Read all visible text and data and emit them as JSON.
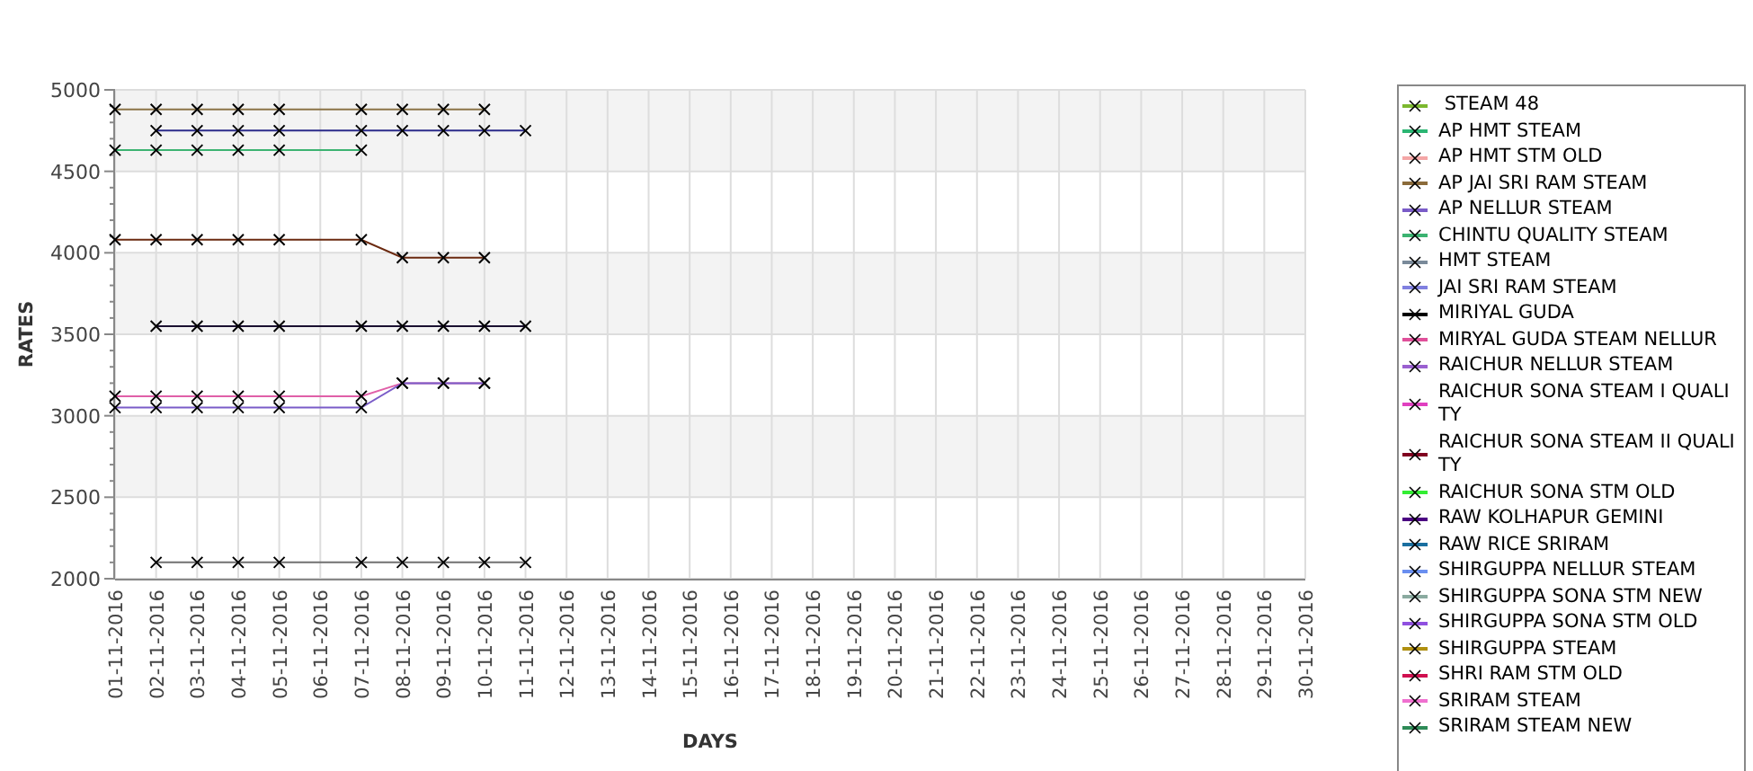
{
  "chart_data": {
    "type": "line",
    "xlabel": "DAYS",
    "ylabel": "RATES",
    "grid": true,
    "categories": [
      "01-11-2016",
      "02-11-2016",
      "03-11-2016",
      "04-11-2016",
      "05-11-2016",
      "06-11-2016",
      "07-11-2016",
      "08-11-2016",
      "09-11-2016",
      "10-11-2016",
      "11-11-2016",
      "12-11-2016",
      "13-11-2016",
      "14-11-2016",
      "15-11-2016",
      "16-11-2016",
      "17-11-2016",
      "18-11-2016",
      "19-11-2016",
      "20-11-2016",
      "21-11-2016",
      "22-11-2016",
      "23-11-2016",
      "24-11-2016",
      "25-11-2016",
      "26-11-2016",
      "27-11-2016",
      "28-11-2016",
      "29-11-2016",
      "30-11-2016"
    ],
    "ylim": [
      2000,
      5000
    ],
    "yticks": [
      2000,
      2500,
      3000,
      3500,
      4000,
      4500,
      5000
    ],
    "series": [
      {
        "color": "#8b7346",
        "marker": "x",
        "values": [
          4880,
          4880,
          4880,
          4880,
          4880,
          null,
          4880,
          4880,
          4880,
          4880,
          null,
          null,
          null,
          null,
          null,
          null,
          null,
          null,
          null,
          null,
          null,
          null,
          null,
          null,
          null,
          null,
          null,
          null,
          null,
          null
        ]
      },
      {
        "color": "#2a2a8a",
        "marker": "x",
        "values": [
          null,
          4750,
          4750,
          4750,
          4750,
          null,
          4750,
          4750,
          4750,
          4750,
          4750,
          null,
          null,
          null,
          null,
          null,
          null,
          null,
          null,
          null,
          null,
          null,
          null,
          null,
          null,
          null,
          null,
          null,
          null,
          null
        ]
      },
      {
        "color": "#3cb371",
        "marker": "x",
        "values": [
          4630,
          4630,
          4630,
          4630,
          4630,
          null,
          4630,
          null,
          null,
          null,
          null,
          null,
          null,
          null,
          null,
          null,
          null,
          null,
          null,
          null,
          null,
          null,
          null,
          null,
          null,
          null,
          null,
          null,
          null,
          null
        ]
      },
      {
        "color": "#6b2a10",
        "marker": "x",
        "values": [
          4080,
          4080,
          4080,
          4080,
          4080,
          null,
          4080,
          3970,
          3970,
          3970,
          null,
          null,
          null,
          null,
          null,
          null,
          null,
          null,
          null,
          null,
          null,
          null,
          null,
          null,
          null,
          null,
          null,
          null,
          null,
          null
        ]
      },
      {
        "color": "#1a1030",
        "marker": "x",
        "values": [
          null,
          3550,
          3550,
          3550,
          3550,
          null,
          3550,
          3550,
          3550,
          3550,
          3550,
          null,
          null,
          null,
          null,
          null,
          null,
          null,
          null,
          null,
          null,
          null,
          null,
          null,
          null,
          null,
          null,
          null,
          null,
          null
        ]
      },
      {
        "color": "#e060a8",
        "marker": "x",
        "values": [
          3120,
          3120,
          3120,
          3120,
          3120,
          null,
          3120,
          3200,
          3200,
          3200,
          null,
          null,
          null,
          null,
          null,
          null,
          null,
          null,
          null,
          null,
          null,
          null,
          null,
          null,
          null,
          null,
          null,
          null,
          null,
          null
        ]
      },
      {
        "color": "#7a5cc8",
        "marker": "x",
        "values": [
          3050,
          3050,
          3050,
          3050,
          3050,
          null,
          3050,
          3200,
          3200,
          3200,
          null,
          null,
          null,
          null,
          null,
          null,
          null,
          null,
          null,
          null,
          null,
          null,
          null,
          null,
          null,
          null,
          null,
          null,
          null,
          null
        ]
      },
      {
        "color": "#707070",
        "marker": "x",
        "values": [
          null,
          2100,
          2100,
          2100,
          2100,
          null,
          2100,
          2100,
          2100,
          2100,
          2100,
          null,
          null,
          null,
          null,
          null,
          null,
          null,
          null,
          null,
          null,
          null,
          null,
          null,
          null,
          null,
          null,
          null,
          null,
          null
        ]
      }
    ]
  },
  "legend": [
    {
      "label": " STEAM 48",
      "color": "#7cb82f"
    },
    {
      "label": "AP HMT STEAM",
      "color": "#2bb673"
    },
    {
      "label": "AP HMT STM OLD",
      "color": "#f4a6a6"
    },
    {
      "label": "AP JAI SRI RAM STEAM",
      "color": "#8b6b3a"
    },
    {
      "label": "AP NELLUR STEAM",
      "color": "#7a5cc8"
    },
    {
      "label": "CHINTU QUALITY STEAM",
      "color": "#3cb371"
    },
    {
      "label": "HMT STEAM",
      "color": "#7a8a9a"
    },
    {
      "label": "JAI SRI RAM STEAM",
      "color": "#8080e0"
    },
    {
      "label": "MIRIYAL GUDA",
      "color": "#000000"
    },
    {
      "label": "MIRYAL GUDA STEAM NELLUR",
      "color": "#e0509a"
    },
    {
      "label": "RAICHUR NELLUR STEAM",
      "color": "#9a60d0"
    },
    {
      "label": "RAICHUR SONA STEAM I QUALITY",
      "color": "#e040c0"
    },
    {
      "label": "RAICHUR SONA STEAM II QUALITY",
      "color": "#800020"
    },
    {
      "label": "RAICHUR SONA STM OLD",
      "color": "#33ee33"
    },
    {
      "label": "RAW KOLHAPUR GEMINI",
      "color": "#4b0082"
    },
    {
      "label": "RAW RICE SRIRAM",
      "color": "#1a6fa0"
    },
    {
      "label": "SHIRGUPPA NELLUR STEAM",
      "color": "#6a8ff0"
    },
    {
      "label": "SHIRGUPPA SONA STM NEW",
      "color": "#8aaaa0"
    },
    {
      "label": "SHIRGUPPA SONA STM OLD",
      "color": "#9050e0"
    },
    {
      "label": "SHIRGUPPA STEAM",
      "color": "#b09010"
    },
    {
      "label": "SHRI RAM STM OLD",
      "color": "#d01050"
    },
    {
      "label": "SRIRAM STEAM",
      "color": "#f070d0"
    },
    {
      "label": "SRIRAM STEAM NEW",
      "color": "#2e8b57"
    }
  ]
}
